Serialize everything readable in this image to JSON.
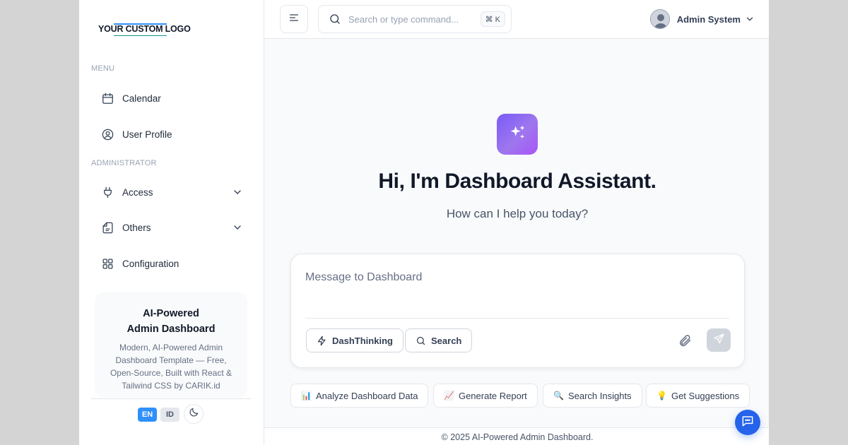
{
  "sidebar": {
    "logo_text": "YOUR CUSTOM LOGO",
    "menu_label": "MENU",
    "admin_label": "ADMINISTRATOR",
    "items": [
      {
        "label": "Calendar",
        "icon": "calendar-icon"
      },
      {
        "label": "User Profile",
        "icon": "user-circle-icon"
      },
      {
        "label": "Access",
        "icon": "plug-icon",
        "expandable": true
      },
      {
        "label": "Others",
        "icon": "document-icon",
        "expandable": true
      },
      {
        "label": "Configuration",
        "icon": "grid-icon"
      }
    ],
    "promo": {
      "title_line1": "AI-Powered",
      "title_line2": "Admin Dashboard",
      "description": "Modern, AI-Powered Admin Dashboard Template — Free, Open-Source, Built with React & Tailwind CSS by CARIK.id"
    },
    "language": {
      "options": [
        "EN",
        "ID"
      ],
      "selected": "EN"
    },
    "theme_toggle_icon": "moon-icon"
  },
  "header": {
    "search_placeholder": "Search or type command...",
    "shortcut": "⌘ K",
    "user_name": "Admin System"
  },
  "assistant": {
    "headline": "Hi, I'm Dashboard Assistant.",
    "subheadline": "How can I help you today?",
    "input_placeholder": "Message to Dashboard",
    "mode_buttons": [
      {
        "label": "DashThinking",
        "icon": "bolt-icon"
      },
      {
        "label": "Search",
        "icon": "search-icon"
      }
    ],
    "suggestions": [
      {
        "emoji": "📊",
        "label": "Analyze Dashboard Data"
      },
      {
        "emoji": "📈",
        "label": "Generate Report"
      },
      {
        "emoji": "🔍",
        "label": "Search Insights"
      },
      {
        "emoji": "💡",
        "label": "Get Suggestions"
      }
    ]
  },
  "footer": {
    "text": "© 2025 AI-Powered Admin Dashboard."
  },
  "colors": {
    "accent": "#2e90fa",
    "assistant_gradient_start": "#7a5af8",
    "assistant_gradient_end": "#a855f7",
    "chat_fab": "#2563eb"
  }
}
